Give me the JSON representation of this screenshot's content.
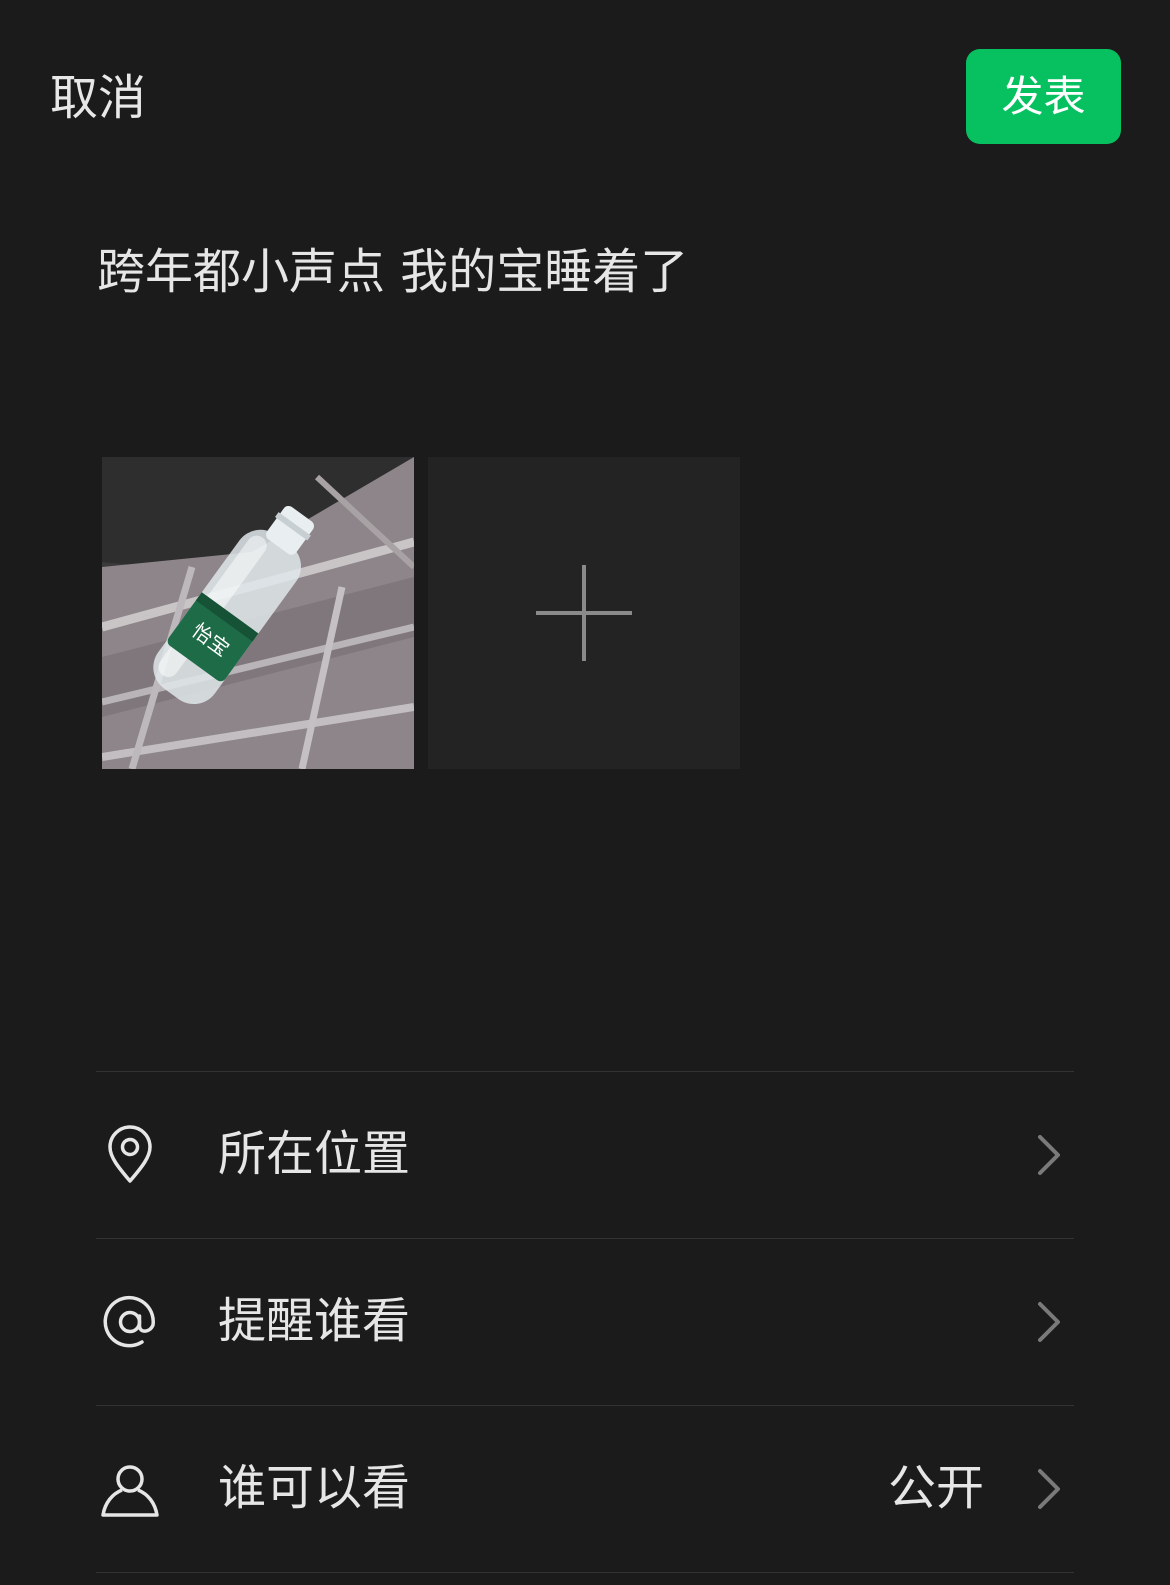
{
  "header": {
    "cancel_label": "取消",
    "publish_label": "发表"
  },
  "post": {
    "text": "跨年都小声点 我的宝睡着了"
  },
  "photo": {
    "bottle_label": "怡宝"
  },
  "settings": {
    "location": {
      "label": "所在位置",
      "icon": "location-pin-icon"
    },
    "mention": {
      "label": "提醒谁看",
      "icon": "at-icon"
    },
    "visibility": {
      "label": "谁可以看",
      "value": "公开",
      "icon": "person-icon"
    }
  },
  "colors": {
    "background": "#1b1b1b",
    "accent": "#07c160",
    "tile": "#232323",
    "divider": "#333333"
  }
}
